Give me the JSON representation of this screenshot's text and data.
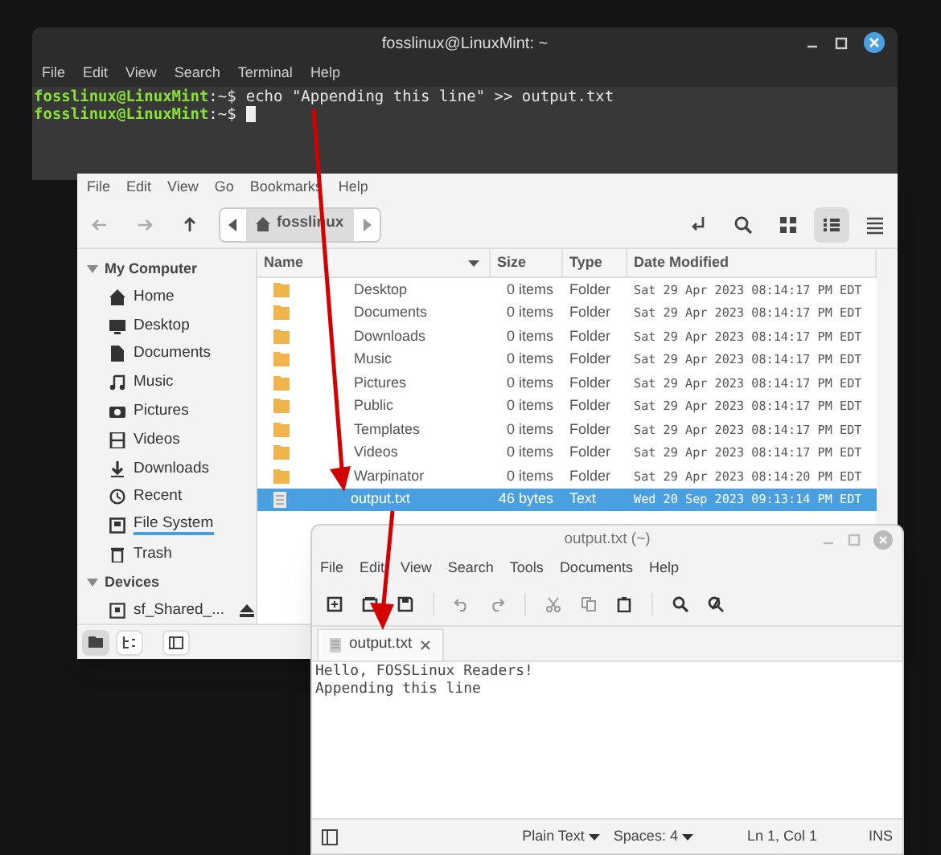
{
  "terminal": {
    "title": "fosslinux@LinuxMint: ~",
    "menu": [
      "File",
      "Edit",
      "View",
      "Search",
      "Terminal",
      "Help"
    ],
    "lines": [
      {
        "user": "fosslinux@LinuxMint",
        "path": ":~$",
        "command": "echo \"Appending this line\" >> output.txt",
        "cursor": false
      },
      {
        "user": "fosslinux@LinuxMint",
        "path": ":~$",
        "cursor": true
      }
    ]
  },
  "file_manager": {
    "menu": [
      "File",
      "Edit",
      "View",
      "Go",
      "Bookmarks",
      "Help"
    ],
    "path_button": "fosslinux",
    "sidebar": [
      {
        "heading": "My Computer",
        "expanded": true,
        "items": [
          {
            "label": "Home",
            "kind": "home",
            "selected": false
          },
          {
            "label": "Desktop",
            "kind": "desktop",
            "selected": false
          },
          {
            "label": "Documents",
            "kind": "document",
            "selected": false
          },
          {
            "label": "Music",
            "kind": "music",
            "selected": false
          },
          {
            "label": "Pictures",
            "kind": "camera",
            "selected": false
          },
          {
            "label": "Videos",
            "kind": "film",
            "selected": false
          },
          {
            "label": "Downloads",
            "kind": "download",
            "selected": false
          },
          {
            "label": "Recent",
            "kind": "clock",
            "selected": false
          },
          {
            "label": "File System",
            "kind": "drive",
            "selected": true
          },
          {
            "label": "Trash",
            "kind": "trash",
            "selected": false
          }
        ]
      },
      {
        "heading": "Devices",
        "expanded": true,
        "items": [
          {
            "label": "sf_Shared_...",
            "kind": "disk",
            "selected": false,
            "eject": true
          }
        ]
      }
    ],
    "columns": [
      "Name",
      "Size",
      "Type",
      "Date Modified"
    ],
    "rows": [
      {
        "name": "Desktop",
        "size": "0 items",
        "type": "Folder",
        "modified": "Sat 29 Apr 2023 08:14:17 PM EDT",
        "kind": "folder",
        "selected": false
      },
      {
        "name": "Documents",
        "size": "0 items",
        "type": "Folder",
        "modified": "Sat 29 Apr 2023 08:14:17 PM EDT",
        "kind": "folder",
        "selected": false
      },
      {
        "name": "Downloads",
        "size": "0 items",
        "type": "Folder",
        "modified": "Sat 29 Apr 2023 08:14:17 PM EDT",
        "kind": "folder",
        "selected": false
      },
      {
        "name": "Music",
        "size": "0 items",
        "type": "Folder",
        "modified": "Sat 29 Apr 2023 08:14:17 PM EDT",
        "kind": "folder",
        "selected": false
      },
      {
        "name": "Pictures",
        "size": "0 items",
        "type": "Folder",
        "modified": "Sat 29 Apr 2023 08:14:17 PM EDT",
        "kind": "folder",
        "selected": false
      },
      {
        "name": "Public",
        "size": "0 items",
        "type": "Folder",
        "modified": "Sat 29 Apr 2023 08:14:17 PM EDT",
        "kind": "folder",
        "selected": false
      },
      {
        "name": "Templates",
        "size": "0 items",
        "type": "Folder",
        "modified": "Sat 29 Apr 2023 08:14:17 PM EDT",
        "kind": "folder",
        "selected": false
      },
      {
        "name": "Videos",
        "size": "0 items",
        "type": "Folder",
        "modified": "Sat 29 Apr 2023 08:14:17 PM EDT",
        "kind": "folder",
        "selected": false
      },
      {
        "name": "Warpinator",
        "size": "0 items",
        "type": "Folder",
        "modified": "Sat 29 Apr 2023 08:14:20 PM EDT",
        "kind": "folder",
        "selected": false
      },
      {
        "name": "output.txt",
        "size": "46 bytes",
        "type": "Text",
        "modified": "Wed 20 Sep 2023 09:13:14 PM EDT",
        "kind": "file",
        "selected": true
      }
    ]
  },
  "editor": {
    "title": "output.txt (~)",
    "menu": [
      "File",
      "Edit",
      "View",
      "Search",
      "Tools",
      "Documents",
      "Help"
    ],
    "tab": "output.txt",
    "lines": [
      "Hello, FOSSLinux Readers!",
      "Appending this line"
    ],
    "status": {
      "syntax": "Plain Text",
      "spaces": "Spaces: 4",
      "position": "Ln 1, Col 1",
      "mode": "INS"
    }
  }
}
